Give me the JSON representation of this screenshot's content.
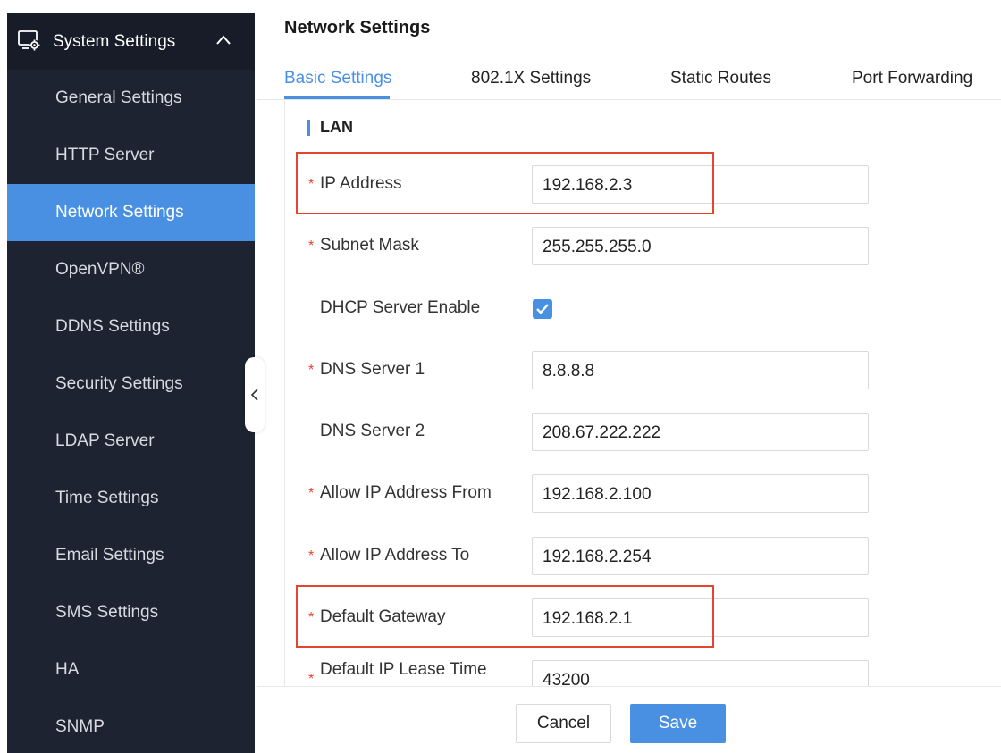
{
  "sidebar": {
    "header_title": "System Settings",
    "header_icon": "system-settings-icon",
    "items": [
      {
        "label": "General Settings",
        "active": false
      },
      {
        "label": "HTTP Server",
        "active": false
      },
      {
        "label": "Network Settings",
        "active": true
      },
      {
        "label": "OpenVPN®",
        "active": false
      },
      {
        "label": "DDNS Settings",
        "active": false
      },
      {
        "label": "Security Settings",
        "active": false
      },
      {
        "label": "LDAP Server",
        "active": false
      },
      {
        "label": "Time Settings",
        "active": false
      },
      {
        "label": "Email Settings",
        "active": false
      },
      {
        "label": "SMS Settings",
        "active": false
      },
      {
        "label": "HA",
        "active": false
      },
      {
        "label": "SNMP",
        "active": false
      }
    ]
  },
  "page": {
    "title": "Network Settings"
  },
  "tabs": [
    {
      "label": "Basic Settings",
      "active": true
    },
    {
      "label": "802.1X Settings",
      "active": false
    },
    {
      "label": "Static Routes",
      "active": false
    },
    {
      "label": "Port Forwarding",
      "active": false
    }
  ],
  "section": {
    "title": "LAN"
  },
  "form": {
    "ip_address": {
      "label": "IP Address",
      "required": "*",
      "value": "192.168.2.3"
    },
    "subnet_mask": {
      "label": "Subnet Mask",
      "required": "*",
      "value": "255.255.255.0"
    },
    "dhcp_server_enable": {
      "label": "DHCP Server Enable",
      "checked": true
    },
    "dns_server_1": {
      "label": "DNS Server 1",
      "required": "*",
      "value": "8.8.8.8"
    },
    "dns_server_2": {
      "label": "DNS Server 2",
      "value": "208.67.222.222"
    },
    "allow_ip_from": {
      "label": "Allow IP Address From",
      "required": "*",
      "value": "192.168.2.100"
    },
    "allow_ip_to": {
      "label": "Allow IP Address To",
      "required": "*",
      "value": "192.168.2.254"
    },
    "default_gateway": {
      "label": "Default Gateway",
      "required": "*",
      "value": "192.168.2.1"
    },
    "lease_time": {
      "label": "Default IP Lease Time",
      "required": "*",
      "value": "43200"
    }
  },
  "footer": {
    "cancel_label": "Cancel",
    "save_label": "Save"
  },
  "colors": {
    "accent": "#4a90e2",
    "sidebar_bg": "#1e2331",
    "highlight": "#e3452f"
  }
}
